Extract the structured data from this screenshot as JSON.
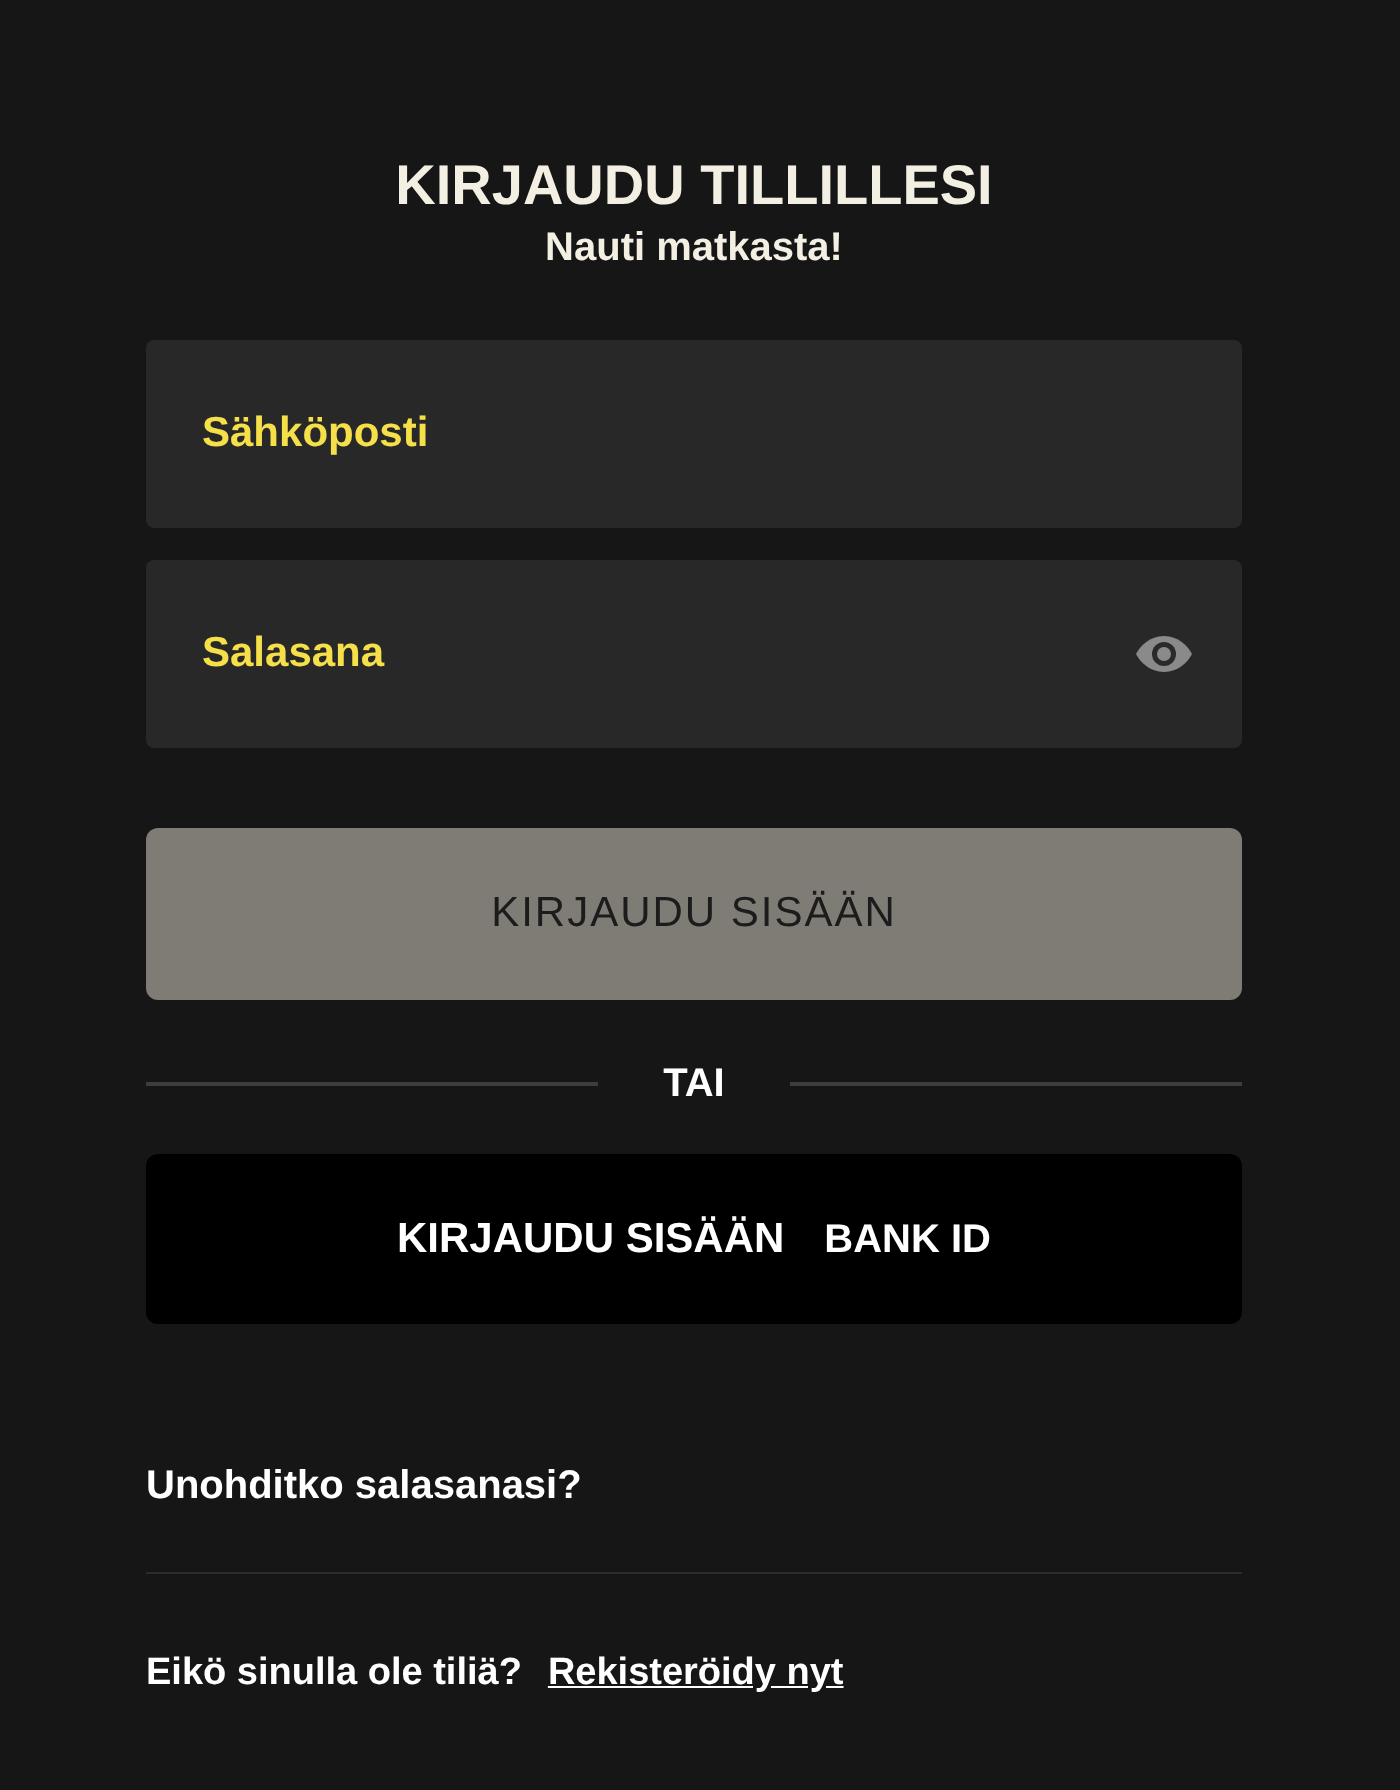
{
  "header": {
    "title": "KIRJAUDU TILLILLESI",
    "subtitle": "Nauti matkasta!"
  },
  "fields": [
    {
      "placeholder": "Sähköposti",
      "kind": "email"
    },
    {
      "placeholder": "Salasana",
      "kind": "password"
    }
  ],
  "submit": {
    "label": "KIRJAUDU SISÄÄN",
    "disabled": true
  },
  "divider": {
    "label": "TAI"
  },
  "bank_button": {
    "label": "KIRJAUDU SISÄÄN",
    "suffix": "BANK ID"
  },
  "forgot_link": "Unohditko salasanasi?",
  "register": {
    "text": "Eikö sinulla ole tiliä?",
    "link": "Rekisteröidy nyt"
  }
}
